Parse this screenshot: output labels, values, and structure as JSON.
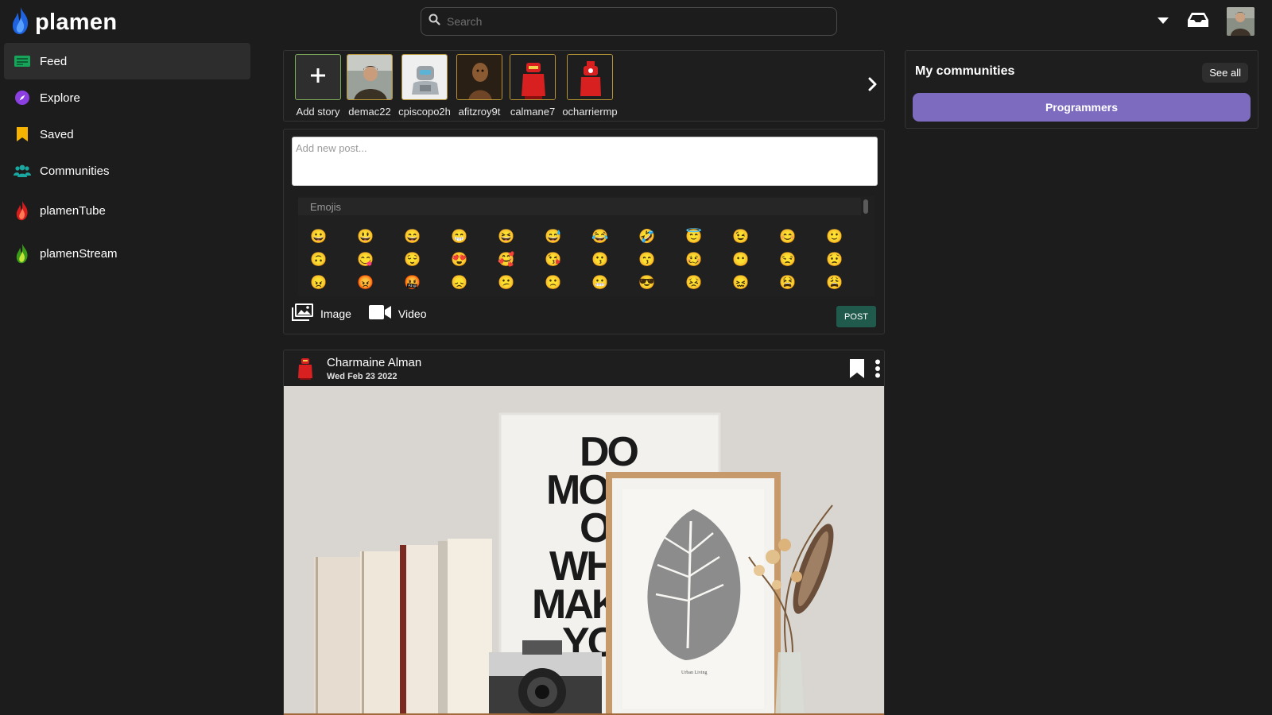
{
  "app": {
    "name": "plamen"
  },
  "search": {
    "placeholder": "Search"
  },
  "sidebar": {
    "items": [
      {
        "label": "Feed",
        "icon": "feed-icon",
        "active": true
      },
      {
        "label": "Explore",
        "icon": "compass-icon"
      },
      {
        "label": "Saved",
        "icon": "bookmark-icon"
      },
      {
        "label": "Communities",
        "icon": "users-icon"
      },
      {
        "label": "plamenTube",
        "icon": "red-flame-icon"
      },
      {
        "label": "plamenStream",
        "icon": "green-flame-icon"
      }
    ]
  },
  "stories": {
    "add_label": "Add story",
    "items": [
      {
        "user": "demac22",
        "thumb": "man-portrait"
      },
      {
        "user": "cpiscopo2h",
        "thumb": "robot"
      },
      {
        "user": "afitzroy9t",
        "thumb": "figure"
      },
      {
        "user": "calmane7",
        "thumb": "red-character"
      },
      {
        "user": "ocharriermp",
        "thumb": "red-character"
      }
    ]
  },
  "composer": {
    "placeholder": "Add new post...",
    "emoji_header": "Emojis",
    "emojis": [
      [
        "😀",
        "😃",
        "😄",
        "😁",
        "😆",
        "😅",
        "😂",
        "🤣",
        "😇",
        "😉",
        "😊",
        "🙂"
      ],
      [
        "🙃",
        "😋",
        "😌",
        "😍",
        "🥰",
        "😘",
        "😗",
        "😙",
        "🥴",
        "😶",
        "😒",
        "😟"
      ],
      [
        "😠",
        "😡",
        "🤬",
        "😞",
        "😕",
        "🙁",
        "😬",
        "😎",
        "😣",
        "😖",
        "😫",
        "😩"
      ]
    ],
    "image_label": "Image",
    "video_label": "Video",
    "post_label": "POST"
  },
  "post": {
    "author": "Charmaine Alman",
    "date": "Wed Feb 23 2022",
    "poster_text": [
      "DO",
      "MORE",
      "OF",
      "WHAT",
      "MAKES",
      "YOU"
    ],
    "frame_caption": "Urban Living"
  },
  "communities": {
    "title": "My communities",
    "see_all": "See all",
    "items": [
      "Programmers"
    ]
  },
  "colors": {
    "background": "#1c1c1c",
    "panel": "#1e1e1e",
    "community_accent": "#7d6bc0",
    "post_button": "#1f5a4c",
    "story_border": "#b89535"
  }
}
